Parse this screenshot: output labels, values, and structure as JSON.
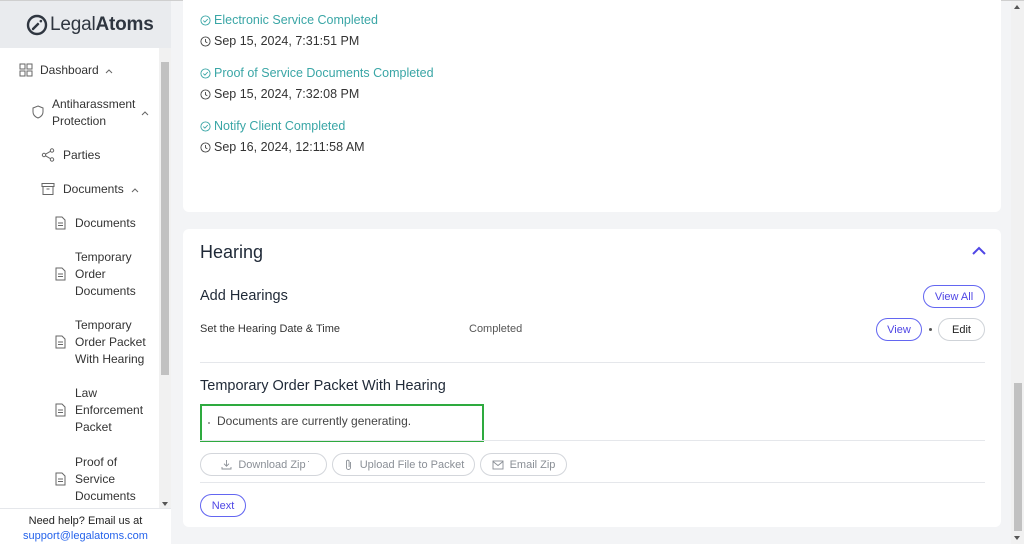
{
  "logo": {
    "prefix": "Legal",
    "suffix": "Atoms"
  },
  "sidebar": {
    "items": [
      {
        "label": "Dashboard",
        "icon": "grid-icon"
      },
      {
        "label": "Antiharassment Protection",
        "line1": "Antiharassment",
        "line2": "Protection",
        "icon": "shield-icon"
      },
      {
        "label": "Parties",
        "icon": "share-icon"
      },
      {
        "label": "Documents",
        "icon": "archive-icon"
      },
      {
        "label": "Documents",
        "icon": "file-icon"
      },
      {
        "label": "Temporary Order Documents",
        "lines": [
          "Temporary",
          "Order",
          "Documents"
        ],
        "icon": "file-icon"
      },
      {
        "label": "Temporary Order Packet With Hearing",
        "lines": [
          "Temporary",
          "Order Packet",
          "With Hearing"
        ],
        "icon": "file-icon"
      },
      {
        "label": "Law Enforcement Packet",
        "lines": [
          "Law",
          "Enforcement",
          "Packet"
        ],
        "icon": "file-icon"
      },
      {
        "label": "Proof of Service Documents",
        "lines": [
          "Proof of",
          "Service",
          "Documents"
        ],
        "icon": "file-icon"
      }
    ],
    "help_text": "Need help? Email us at",
    "help_email": "support@legalatoms.com"
  },
  "timeline": [
    {
      "title": "Electronic Service Completed",
      "time": "Sep 15, 2024, 7:31:51 PM"
    },
    {
      "title": "Proof of Service Documents Completed",
      "time": "Sep 15, 2024, 7:32:08 PM"
    },
    {
      "title": "Notify Client Completed",
      "time": "Sep 16, 2024, 12:11:58 AM"
    }
  ],
  "hearing": {
    "title": "Hearing",
    "add_title": "Add Hearings",
    "view_all": "View All",
    "row_label": "Set the Hearing Date & Time",
    "row_status": "Completed",
    "view": "View",
    "edit": "Edit",
    "packet_title": "Temporary Order Packet With Hearing",
    "generating_text": "Documents are currently generating.",
    "download_zip": "Download Zip",
    "upload_file": "Upload File to Packet",
    "email_zip": "Email Zip",
    "next": "Next"
  },
  "colors": {
    "teal": "#3aa6a6",
    "indigo": "#4f46e5",
    "green_box": "#2eaa3f",
    "link_blue": "#2563eb"
  }
}
